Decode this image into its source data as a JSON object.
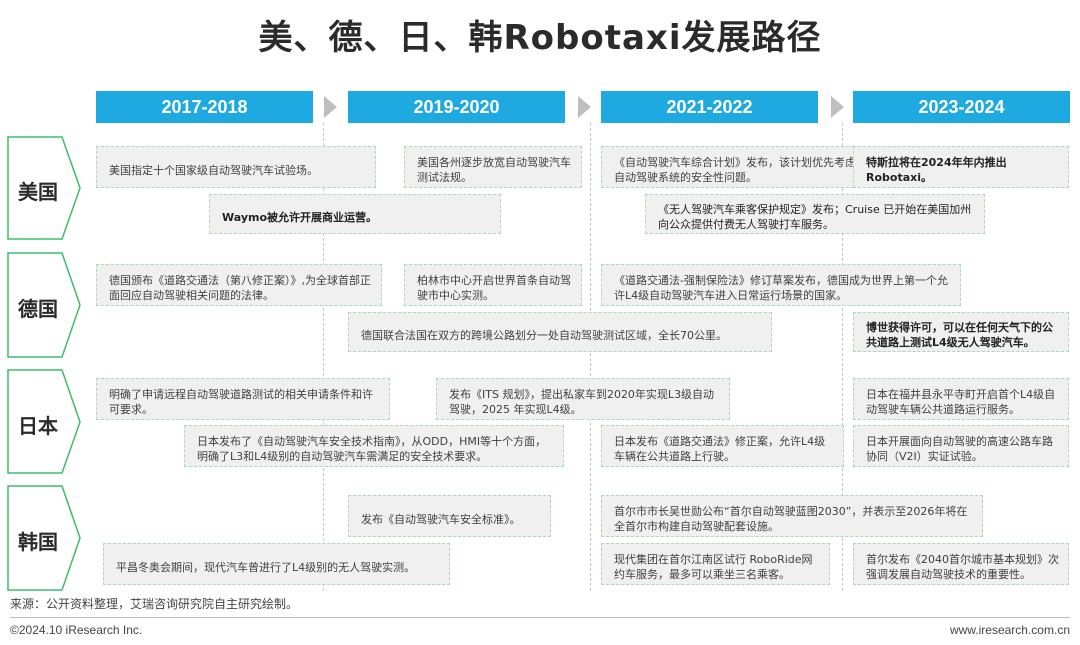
{
  "title": "美、德、日、韩Robotaxi发展路径",
  "periods": [
    "2017-2018",
    "2019-2020",
    "2021-2022",
    "2023-2024"
  ],
  "countries": [
    "美国",
    "德国",
    "日本",
    "韩国"
  ],
  "events": {
    "us": [
      "美国指定十个国家级自动驾驶汽车试验场。",
      "Waymo被允许开展商业运营。",
      "美国各州逐步放宽自动驾驶汽车测试法规。",
      "《自动驾驶汽车综合计划》发布，该计划优先考虑了自动驾驶系统的安全性问题。",
      "《无人驾驶汽车乘客保护规定》发布；Cruise 已开始在美国加州向公众提供付费无人驾驶打车服务。",
      "特斯拉将在2024年年内推出Robotaxi。"
    ],
    "de": [
      "德国颁布《道路交通法（第八修正案）》,为全球首部正面回应自动驾驶相关问题的法律。",
      "柏林市中心开启世界首条自动驾驶市中心实测。",
      "德国联合法国在双方的跨境公路划分一处自动驾驶测试区域，全长70公里。",
      "《道路交通法-强制保险法》修订草案发布，德国成为世界上第一个允许L4级自动驾驶汽车进入日常运行场景的国家。",
      "博世获得许可，可以在任何天气下的公共道路上测试L4级无人驾驶汽车。"
    ],
    "jp": [
      "明确了申请远程自动驾驶道路测试的相关申请条件和许可要求。",
      "日本发布了《自动驾驶汽车安全技术指南》，从ODD，HMI等十个方面，明确了L3和L4级别的自动驾驶汽车需满足的安全技术要求。",
      "发布《ITS 规划》，提出私家车到2020年实现L3级自动驾驶，2025 年实现L4级。",
      "日本发布《道路交通法》修正案，允许L4级车辆在公共道路上行驶。",
      "日本在福井县永平寺町开启首个L4级自动驾驶车辆公共道路运行服务。",
      "日本开展面向自动驾驶的高速公路车路协同（V2I）实证试验。"
    ],
    "kr": [
      "平昌冬奥会期间，现代汽车曾进行了L4级别的无人驾驶实测。",
      "发布《自动驾驶汽车安全标准》。",
      "首尔市市长吴世勋公布“首尔自动驾驶蓝图2030”，并表示至2026年将在全首尔市构建自动驾驶配套设施。",
      "现代集团在首尔江南区试行 RoboRide网约车服务，最多可以乘坐三名乘客。",
      "首尔发布《2040首尔城市基本规划》次强调发展自动驾驶技术的重要性。"
    ]
  },
  "footer": {
    "source": "来源：公开资料整理，艾瑞咨询研究院自主研究绘制。",
    "copyright": "©2024.10 iResearch Inc.",
    "site": "www.iresearch.com.cn"
  },
  "colors": {
    "accent": "#1ea9e1",
    "country_border": "#3cbd6b",
    "box_bg": "#f0f0f0"
  }
}
